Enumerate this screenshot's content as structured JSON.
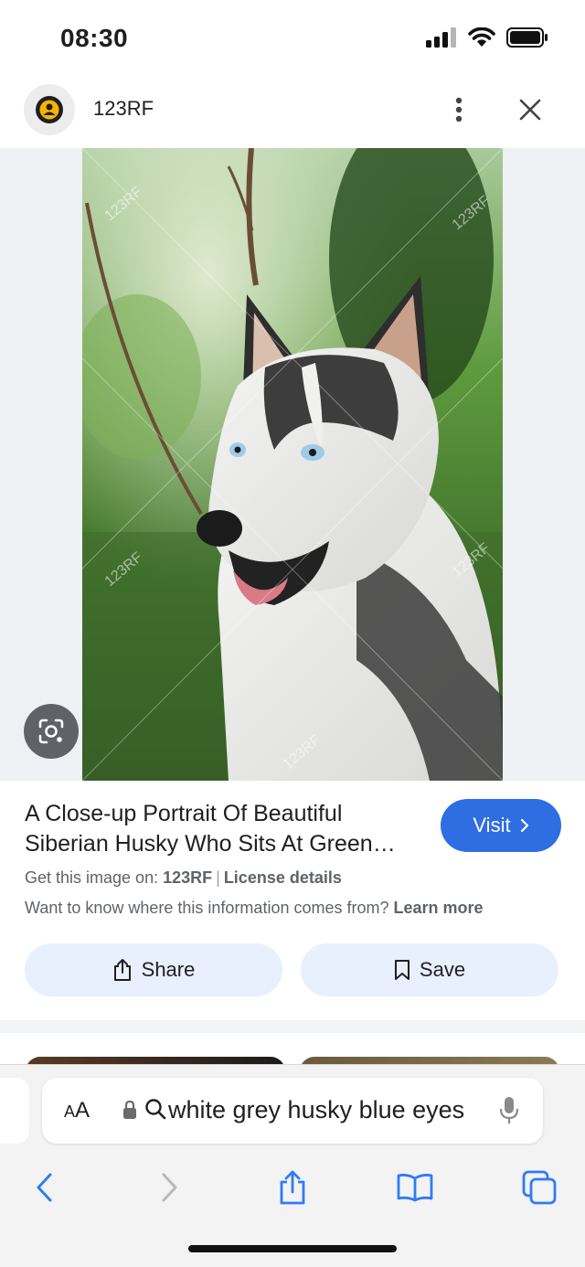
{
  "status_bar": {
    "time": "08:30"
  },
  "header": {
    "source_name": "123RF"
  },
  "image": {
    "watermark": "123RF"
  },
  "result": {
    "title": "A Close-up Portrait Of Beautiful Siberian Husky Who Sits At Green Forest",
    "visit_label": "Visit",
    "get_image_prefix": "Get this image on:",
    "get_image_source": "123RF",
    "separator": "|",
    "license_label": "License details",
    "info_question": "Want to know where this information comes from?",
    "learn_more_label": "Learn more",
    "share_label": "Share",
    "save_label": "Save"
  },
  "browser": {
    "aa_label_big": "A",
    "aa_label_small": "A",
    "address_text": "white grey husky blue eyes"
  },
  "colors": {
    "accent": "#2f6ee2",
    "chip_bg": "#e8f0fe",
    "safari_blue": "#2f7bf6"
  }
}
